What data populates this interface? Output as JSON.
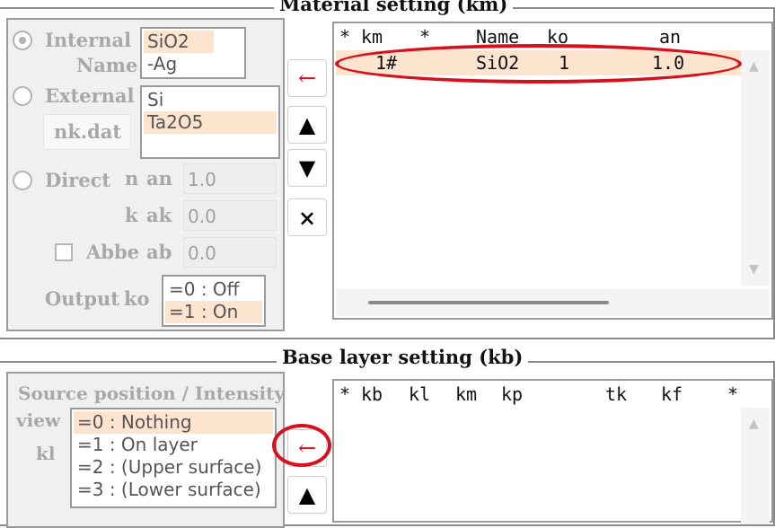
{
  "material": {
    "title": "Material setting (km)",
    "internal_label": "Internal",
    "name_label": "Name",
    "internal_items": [
      "SiO2",
      "-Ag"
    ],
    "external_label": "External",
    "external_items": [
      "Si",
      "Ta2O5"
    ],
    "nkdat_button": "nk.dat",
    "direct_label": "Direct",
    "n_label": "n",
    "an_label": "an",
    "an_value": "1.0",
    "k_label": "k",
    "ak_label": "ak",
    "ak_value": "0.0",
    "abbe_label": "Abbe",
    "ab_label": "ab",
    "ab_value": "0.0",
    "output_label": "Output",
    "ko_label": "ko",
    "output_items": [
      "=0 : Off",
      "=1 : On"
    ],
    "table_headers": [
      "*",
      "km",
      "*",
      "Name",
      "ko",
      "an"
    ],
    "rows": [
      {
        "km": "1",
        "mark": "#",
        "name": "SiO2",
        "ko": "1",
        "an": "1.0"
      }
    ]
  },
  "buttons": {
    "add_icon": "←",
    "up_icon": "▲",
    "down_icon": "▼",
    "delete_icon": "×"
  },
  "base": {
    "title": "Base layer setting (kb)",
    "source_label": "Source position / Intensity",
    "view_label": "view",
    "kl_label": "kl",
    "kl_items": [
      "=0 : Nothing",
      "=1 : On layer",
      "=2 : (Upper surface)",
      "=3 : (Lower surface)"
    ],
    "table_headers": [
      "*",
      "kb",
      "kl",
      "km",
      "kp",
      "tk",
      "kf",
      "*"
    ]
  },
  "colors": {
    "highlight": "#fce4cf",
    "annotation_red": "#d8101c",
    "disabled_text": "#a8a8a8"
  }
}
